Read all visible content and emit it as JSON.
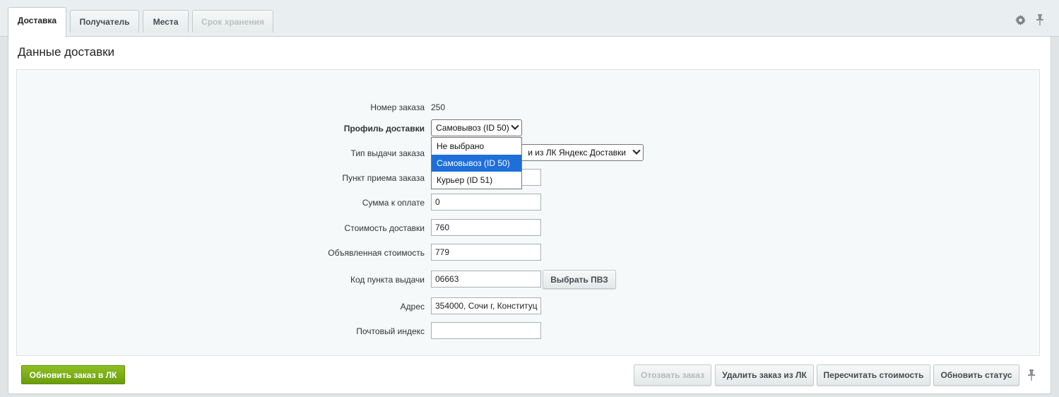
{
  "tabs": [
    {
      "label": "Доставка"
    },
    {
      "label": "Получатель"
    },
    {
      "label": "Места"
    },
    {
      "label": "Срок хранения"
    }
  ],
  "icons": {
    "settings": "gear-icon",
    "pin": "pin-icon"
  },
  "panel": {
    "title": "Данные доставки"
  },
  "form": {
    "order_number": {
      "label": "Номер заказа",
      "value": "250"
    },
    "delivery_profile": {
      "label": "Профиль доставки",
      "selected": "Самовывоз (ID 50)"
    },
    "issue_type": {
      "label": "Тип выдачи заказа",
      "visible_value": "и из ЛК Яндекс Доставки"
    },
    "pickup_point": {
      "label": "Пункт приема заказа",
      "value": ""
    },
    "payment_sum": {
      "label": "Сумма к оплате",
      "value": "0"
    },
    "delivery_cost": {
      "label": "Стоимость доставки",
      "value": "760"
    },
    "declared_value": {
      "label": "Объявленная стоимость",
      "value": "779"
    },
    "pvz_code": {
      "label": "Код пункта выдачи",
      "value": "06663",
      "button": "Выбрать ПВЗ"
    },
    "address": {
      "label": "Адрес",
      "value": "354000, Сочи г, Конституц"
    },
    "postal_index": {
      "label": "Почтовый индекс",
      "value": ""
    }
  },
  "dropdown": {
    "options": [
      "Не выбрано",
      "Самовывоз (ID 50)",
      "Курьер (ID 51)"
    ],
    "selected_index": 1
  },
  "footer": {
    "update_order": "Обновить заказ в ЛК",
    "recall_order": "Отозвать заказ",
    "delete_order": "Удалить заказ из ЛК",
    "recalc_cost": "Пересчитать стоимость",
    "update_status": "Обновить статус"
  },
  "colors": {
    "accent_green": "#7aae16",
    "selected_blue": "#1e6fd9"
  }
}
